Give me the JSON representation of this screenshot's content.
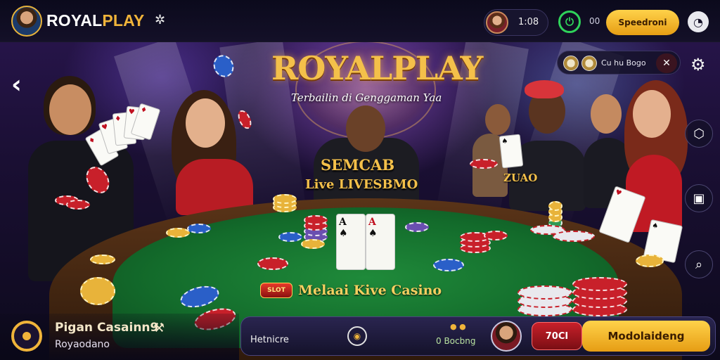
{
  "header": {
    "brand_left": "ROYAL",
    "brand_right": "PLAY",
    "coins": "1:08",
    "count": "00",
    "action_label": "Speedroni"
  },
  "hero": {
    "title": "ROYALPLAY",
    "tagline": "Terbailin di Genggaman Yaa",
    "dealer_sign": "SEMCAB",
    "dealer_sub": "Live LIVESBMO",
    "player_tag": "ZUAO",
    "felt_badge": "SLOT",
    "felt_label": "Melaai Kive Casino"
  },
  "table": {
    "center_card_left": "A",
    "center_card_right": "A"
  },
  "info_panel": {
    "text": "Cu hu Bogo"
  },
  "bottom": {
    "title": "Pigan Casainn9",
    "subtitle": "Royaodano",
    "bar_label": "Hetnicre",
    "score": "0 Bocbng",
    "red_button": "70CI",
    "gold_button": "Modolaideng"
  },
  "colors": {
    "accent_gold": "#f0b43a",
    "felt_green": "#136b2b",
    "power_green": "#2fd35a",
    "button_red": "#c8202a"
  },
  "icons": [
    "back-icon",
    "gear-icon",
    "power-icon",
    "chat-icon",
    "close-icon",
    "tools-icon",
    "settings-icon"
  ]
}
